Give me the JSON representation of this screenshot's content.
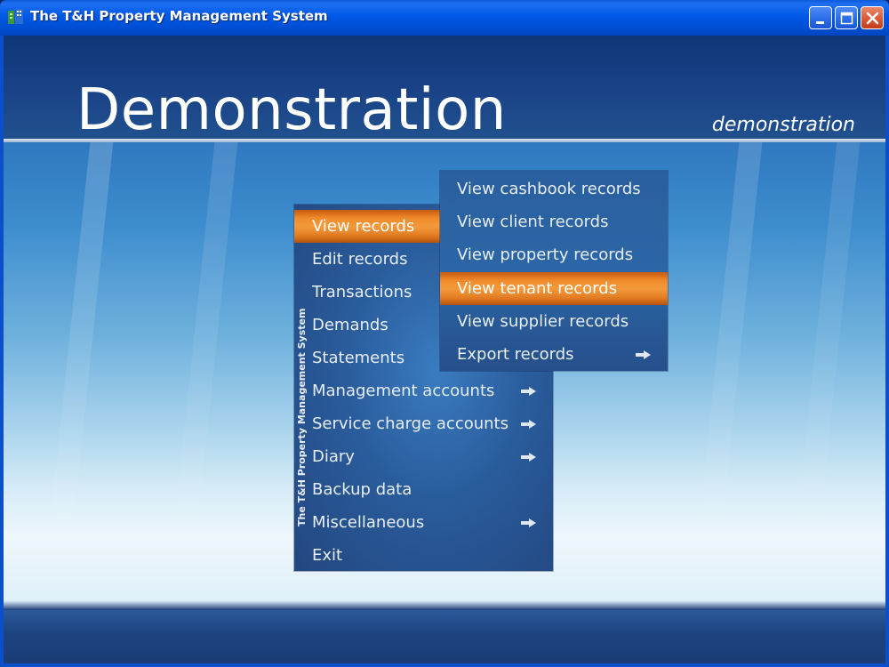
{
  "window": {
    "title": "The T&H Property Management System",
    "title_bar_color": "#0058e6"
  },
  "header": {
    "title": "Demonstration",
    "subtitle": "demonstration"
  },
  "main_menu": {
    "side_label": "The T&H Property Management System",
    "items": [
      {
        "label": "View records",
        "highlighted": true,
        "has_submenu": true
      },
      {
        "label": "Edit records",
        "has_submenu": false
      },
      {
        "label": "Transactions",
        "has_submenu": false
      },
      {
        "label": "Demands",
        "has_submenu": false
      },
      {
        "label": "Statements",
        "has_submenu": false
      },
      {
        "label": "Management accounts",
        "has_submenu": true,
        "icon": "arrow-right-icon"
      },
      {
        "label": "Service charge accounts",
        "has_submenu": true,
        "icon": "arrow-right-icon"
      },
      {
        "label": "Diary",
        "has_submenu": true,
        "icon": "arrow-right-icon"
      },
      {
        "label": "Backup data",
        "has_submenu": false
      },
      {
        "label": "Miscellaneous",
        "has_submenu": true,
        "icon": "arrow-right-icon"
      },
      {
        "label": "Exit",
        "has_submenu": false
      }
    ]
  },
  "sub_menu": {
    "items": [
      {
        "label": "View cashbook records"
      },
      {
        "label": "View client records"
      },
      {
        "label": "View property records"
      },
      {
        "label": "View tenant records",
        "highlighted": true
      },
      {
        "label": "View supplier records"
      },
      {
        "label": "Export records",
        "icon": "arrow-right-icon"
      }
    ]
  },
  "colors": {
    "highlight": "#f08a2a",
    "menu_bg": "#2a5c9c",
    "text": "#e8eef6"
  }
}
